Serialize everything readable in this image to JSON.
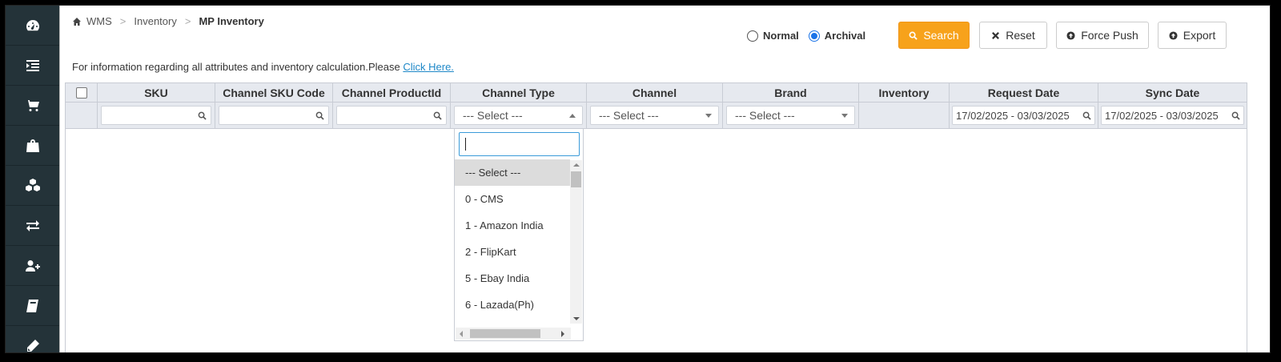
{
  "sidebar": {
    "items": [
      {
        "icon": "dashboard-icon"
      },
      {
        "icon": "indent-list-icon"
      },
      {
        "icon": "cart-icon"
      },
      {
        "icon": "bag-icon"
      },
      {
        "icon": "cubes-icon"
      },
      {
        "icon": "exchange-icon"
      },
      {
        "icon": "user-plus-icon"
      },
      {
        "icon": "book-icon"
      },
      {
        "icon": "pencil-icon"
      }
    ]
  },
  "breadcrumb": {
    "home": "WMS",
    "level2": "Inventory",
    "current": "MP Inventory"
  },
  "info": {
    "text": "For information regarding all attributes and inventory calculation.Please ",
    "link": "Click Here."
  },
  "mode": {
    "normal": "Normal",
    "archival": "Archival",
    "selected": "Archival"
  },
  "toolbar": {
    "search": "Search",
    "reset": "Reset",
    "force_push": "Force Push",
    "export": "Export"
  },
  "colors": {
    "accent": "#f7a21b",
    "sidebar": "#243339",
    "link": "#1e88c8"
  },
  "table": {
    "columns": [
      "SKU",
      "Channel SKU Code",
      "Channel ProductId",
      "Channel Type",
      "Channel",
      "Brand",
      "Inventory",
      "Request Date",
      "Sync Date"
    ],
    "filters": {
      "select_placeholder": "--- Select ---",
      "request_date": "17/02/2025 - 03/03/2025",
      "sync_date": "17/02/2025 - 03/03/2025"
    }
  },
  "channel_type_dropdown": {
    "search_value": "",
    "options": [
      "--- Select ---",
      "0 - CMS",
      "1 - Amazon India",
      "2 - FlipKart",
      "5 - Ebay India",
      "6 - Lazada(Ph)"
    ],
    "selected": "--- Select ---"
  }
}
